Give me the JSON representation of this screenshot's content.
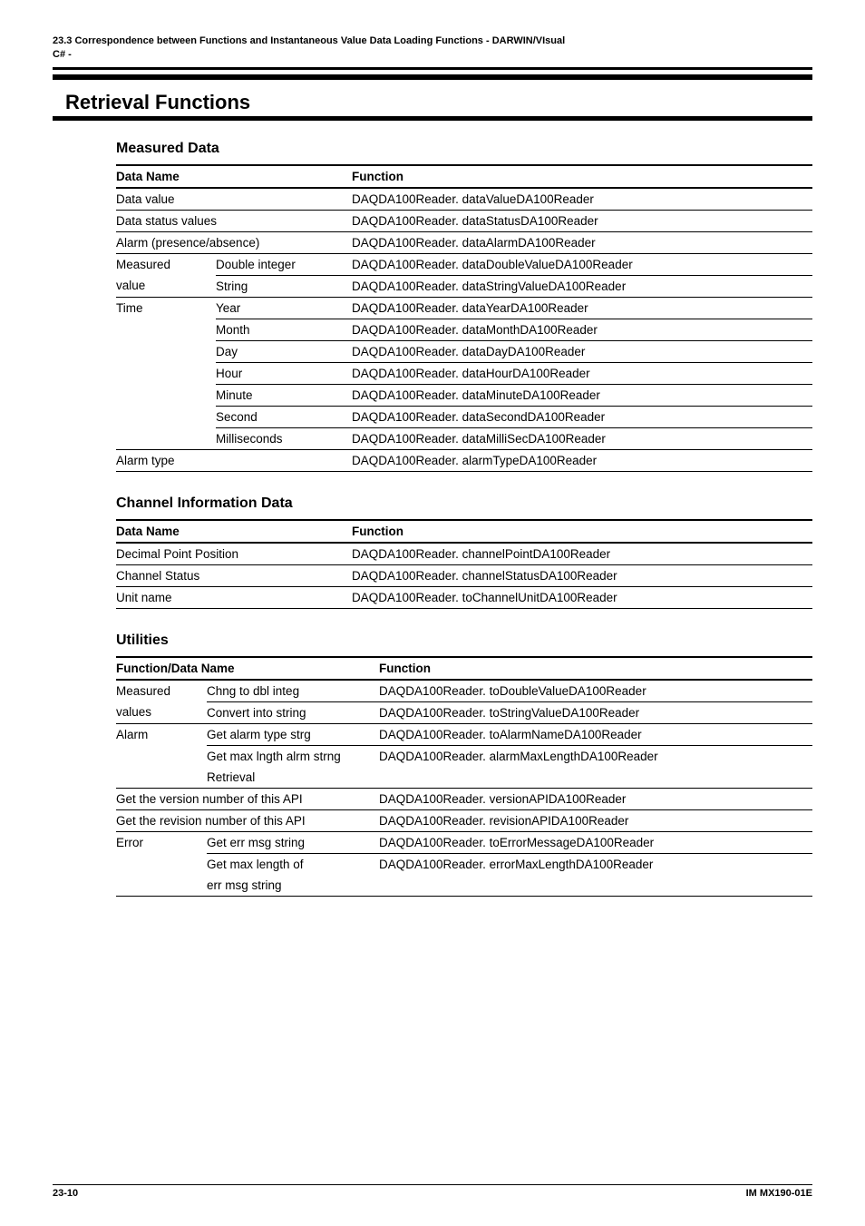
{
  "meta": {
    "line1": "23.3  Correspondence between Functions and Instantaneous Value Data Loading Functions - DARWIN/VIsual",
    "line2": "C# -"
  },
  "section_title": "Retrieval Functions",
  "measured_data": {
    "heading": "Measured Data",
    "header": {
      "c1": "Data Name",
      "c2": "Function"
    },
    "rows": [
      {
        "c1a": "Data value",
        "c1b": "",
        "c2": "DAQDA100Reader. dataValueDA100Reader",
        "rule": "medium",
        "span": true
      },
      {
        "c1a": "Data status values",
        "c1b": "",
        "c2": "DAQDA100Reader. dataStatusDA100Reader",
        "rule": "thin",
        "span": true
      },
      {
        "c1a": "Alarm (presence/absence)",
        "c1b": "",
        "c2": "DAQDA100Reader. dataAlarmDA100Reader",
        "rule": "thin",
        "span": true
      },
      {
        "c1a": "Measured",
        "c1b": "Double integer",
        "c2": "DAQDA100Reader. dataDoubleValueDA100Reader",
        "rule": "thin"
      },
      {
        "c1a": "value",
        "c1b": "String",
        "c2": "DAQDA100Reader. dataStringValueDA100Reader",
        "rule": "none",
        "partial": true
      },
      {
        "c1a": "Time",
        "c1b": "Year",
        "c2": "DAQDA100Reader. dataYearDA100Reader",
        "rule": "thin"
      },
      {
        "c1a": "",
        "c1b": "Month",
        "c2": "DAQDA100Reader. dataMonthDA100Reader",
        "rule": "none",
        "partial": true
      },
      {
        "c1a": "",
        "c1b": "Day",
        "c2": "DAQDA100Reader. dataDayDA100Reader",
        "rule": "none",
        "partial": true
      },
      {
        "c1a": "",
        "c1b": "Hour",
        "c2": "DAQDA100Reader. dataHourDA100Reader",
        "rule": "none",
        "partial": true
      },
      {
        "c1a": "",
        "c1b": "Minute",
        "c2": "DAQDA100Reader. dataMinuteDA100Reader",
        "rule": "none",
        "partial": true
      },
      {
        "c1a": "",
        "c1b": "Second",
        "c2": "DAQDA100Reader. dataSecondDA100Reader",
        "rule": "none",
        "partial": true
      },
      {
        "c1a": "",
        "c1b": "Milliseconds",
        "c2": "DAQDA100Reader. dataMilliSecDA100Reader",
        "rule": "none",
        "partial": true
      },
      {
        "c1a": "Alarm type",
        "c1b": "",
        "c2": "DAQDA100Reader. alarmTypeDA100Reader",
        "rule": "thin",
        "span": true,
        "last": true
      }
    ]
  },
  "channel_info": {
    "heading": "Channel Information Data",
    "header": {
      "c1": "Data Name",
      "c2": "Function"
    },
    "rows": [
      {
        "c1": "Decimal Point Position",
        "c2": "DAQDA100Reader. channelPointDA100Reader",
        "rule": "medium"
      },
      {
        "c1": "Channel Status",
        "c2": "DAQDA100Reader. channelStatusDA100Reader",
        "rule": "thin"
      },
      {
        "c1": "Unit name",
        "c2": "DAQDA100Reader. toChannelUnitDA100Reader",
        "rule": "thin",
        "last": true
      }
    ]
  },
  "utilities": {
    "heading": "Utilities",
    "header": {
      "c1": "Function/Data Name",
      "c2": "Function"
    },
    "rows": [
      {
        "c1a": "Measured",
        "c1b": "Chng to dbl integ",
        "c2": "DAQDA100Reader. toDoubleValueDA100Reader",
        "rule": "medium"
      },
      {
        "c1a": "values",
        "c1b": "Convert into string",
        "c2": "DAQDA100Reader. toStringValueDA100Reader",
        "rule": "none",
        "partial": true
      },
      {
        "c1a": "Alarm",
        "c1b": "Get alarm type strg",
        "c2": "DAQDA100Reader. toAlarmNameDA100Reader",
        "rule": "thin"
      },
      {
        "c1a": "",
        "c1b": "Get max lngth alrm strng",
        "c2": "DAQDA100Reader. alarmMaxLengthDA100Reader",
        "rule": "none",
        "partial": true
      },
      {
        "c1a": "",
        "c1b": "Retrieval",
        "c2": "",
        "rule": "none"
      },
      {
        "c1a": "Get the version number of this API",
        "c1b": "",
        "c2": "DAQDA100Reader. versionAPIDA100Reader",
        "rule": "thin",
        "span": true
      },
      {
        "c1a": "Get the revision number of this API",
        "c1b": "",
        "c2": "DAQDA100Reader. revisionAPIDA100Reader",
        "rule": "thin",
        "span": true
      },
      {
        "c1a": "Error",
        "c1b": "Get err msg string",
        "c2": "DAQDA100Reader. toErrorMessageDA100Reader",
        "rule": "thin"
      },
      {
        "c1a": "",
        "c1b": "Get max length of",
        "c2": "DAQDA100Reader. errorMaxLengthDA100Reader",
        "rule": "none",
        "partial": true
      },
      {
        "c1a": "",
        "c1b": "err msg string",
        "c2": "",
        "rule": "none",
        "last": true
      }
    ]
  },
  "footer": {
    "left": "23-10",
    "right": "IM MX190-01E"
  }
}
